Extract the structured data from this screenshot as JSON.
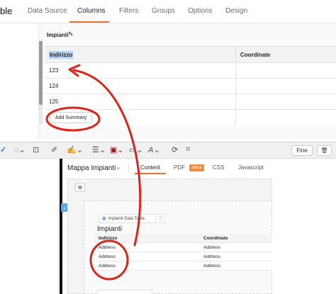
{
  "app": {
    "title_fragment": "ble"
  },
  "top_tabs": [
    {
      "label": "Data Source",
      "active": false
    },
    {
      "label": "Columns",
      "active": true
    },
    {
      "label": "Filters",
      "active": false
    },
    {
      "label": "Groups",
      "active": false
    },
    {
      "label": "Options",
      "active": false
    },
    {
      "label": "Design",
      "active": false
    }
  ],
  "section": {
    "label": "Impianti"
  },
  "grid": {
    "headers": [
      "Indirizzo",
      "Coordinate"
    ],
    "rows": [
      [
        "123",
        ""
      ],
      [
        "124",
        ""
      ],
      [
        "125",
        ""
      ]
    ]
  },
  "add_summary_label": "Add Summary",
  "toolbar": {
    "fine_label": "Fine"
  },
  "editor": {
    "title": "Mappa Impianti",
    "tabs": [
      "Content",
      "PDF",
      "CSS",
      "Javascript"
    ],
    "alpha_badge": "alpha"
  },
  "component": {
    "pill_label": "Impianti Data Table",
    "title": "Impianti",
    "headers": [
      "Indirizzo",
      "Coordinate"
    ],
    "rows": [
      [
        "Address",
        "Address"
      ],
      [
        "Address",
        "Address"
      ],
      [
        "Address",
        "Address"
      ]
    ]
  },
  "colors": {
    "accent": "#e8742c",
    "annotation": "#d8261c",
    "selection": "#b7d2f0"
  },
  "icons": [
    "pencil-icon",
    "globe-icon",
    "info-icon",
    "table-icon",
    "trash-icon",
    "chevron-left-icon"
  ]
}
